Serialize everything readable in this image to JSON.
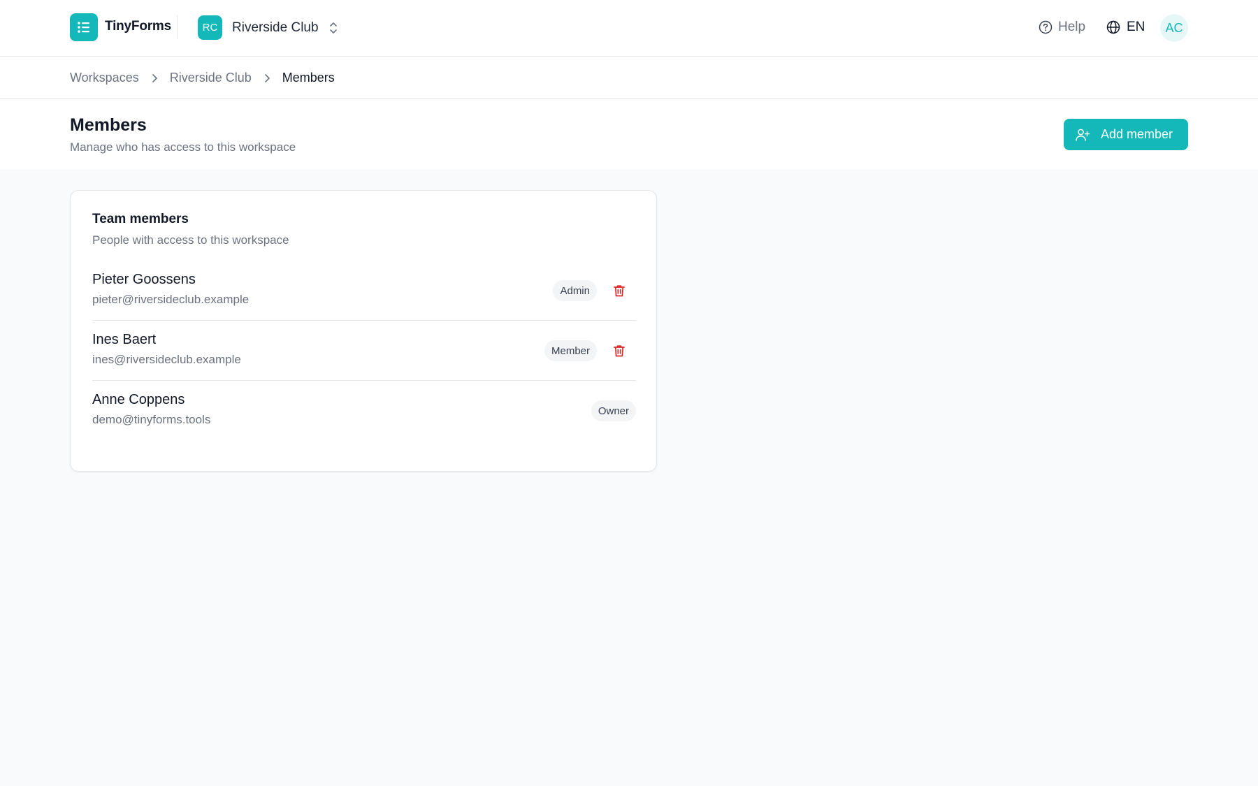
{
  "app": {
    "brand": "TinyForms",
    "logo_icon": "list-icon",
    "accent_color": "#14b8b8"
  },
  "workspace": {
    "initials": "RC",
    "name": "Riverside Club"
  },
  "header_right": {
    "help_label": "Help",
    "language": "EN",
    "user_initials": "AC"
  },
  "breadcrumb": {
    "items": [
      "Workspaces",
      "Riverside Club",
      "Members"
    ]
  },
  "page": {
    "title": "Members",
    "subtitle": "Manage who has access to this workspace",
    "add_button_label": "Add member"
  },
  "card": {
    "title": "Team members",
    "subtitle": "People with access to this workspace",
    "members": [
      {
        "name": "Pieter Goossens",
        "email": "pieter@riversideclub.example",
        "role": "Admin",
        "removable": true
      },
      {
        "name": "Ines Baert",
        "email": "ines@riversideclub.example",
        "role": "Member",
        "removable": true
      },
      {
        "name": "Anne Coppens",
        "email": "demo@tinyforms.tools",
        "role": "Owner",
        "removable": false
      }
    ]
  },
  "colors": {
    "delete": "#dc2626",
    "muted_text": "#6b7280",
    "badge_bg": "#f3f4f6"
  }
}
